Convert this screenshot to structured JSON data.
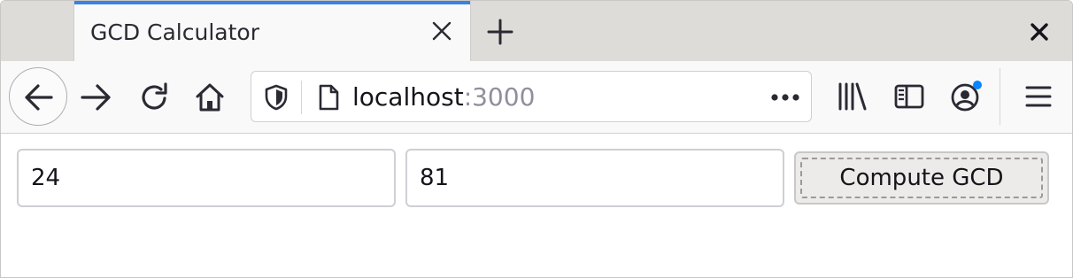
{
  "browser": {
    "tab": {
      "title": "GCD Calculator",
      "close_icon": "close-icon"
    },
    "new_tab_icon": "plus-icon",
    "window_close_icon": "close-icon",
    "nav": {
      "back_icon": "arrow-left-icon",
      "forward_icon": "arrow-right-icon",
      "reload_icon": "reload-icon",
      "home_icon": "home-icon"
    },
    "urlbar": {
      "security_icon": "shield-icon",
      "page_icon": "page-icon",
      "host": "localhost",
      "port": ":3000",
      "more_icon": "more-horizontal-icon"
    },
    "toolbar": {
      "library_icon": "library-icon",
      "sidebar_icon": "sidebar-icon",
      "account_icon": "account-icon",
      "menu_icon": "hamburger-menu-icon"
    },
    "colors": {
      "tab_accent": "#3a83e0",
      "account_badge": "#0a84ff",
      "port_text": "#8f8f9d"
    }
  },
  "page": {
    "first_number": "24",
    "second_number": "81",
    "compute_button_label": "Compute GCD"
  }
}
